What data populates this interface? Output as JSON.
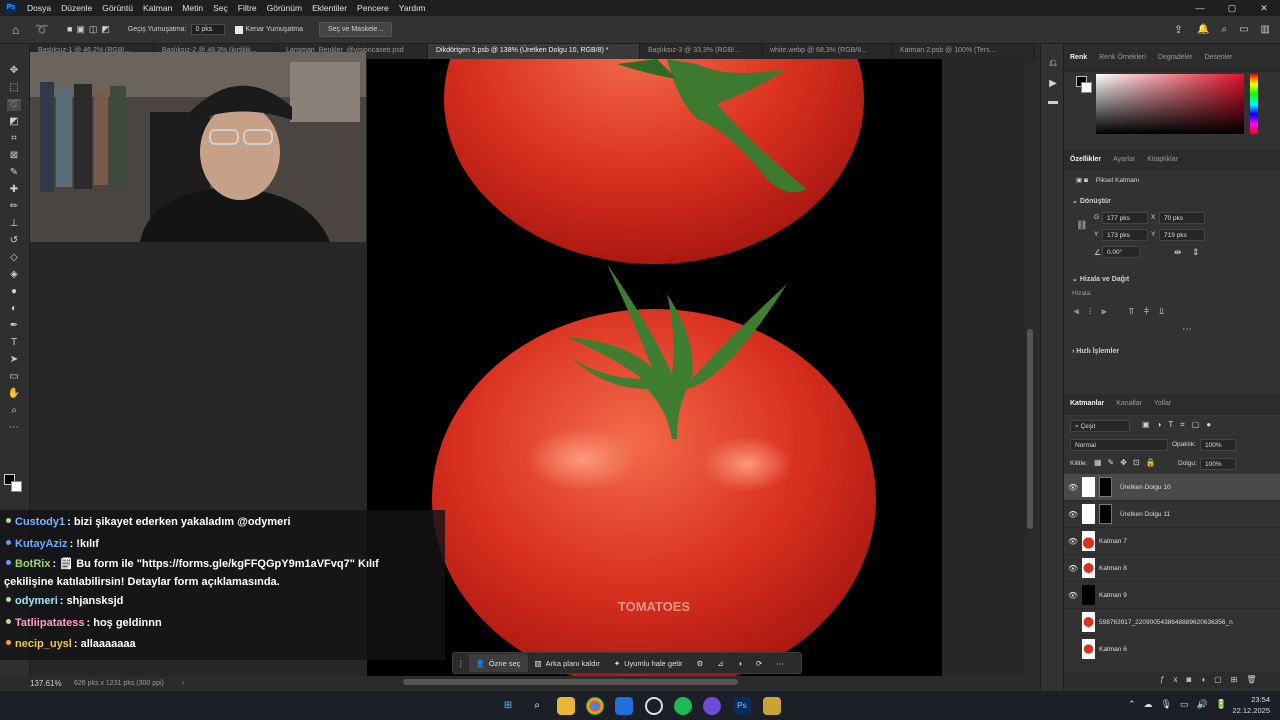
{
  "app": {
    "logo": "Ps"
  },
  "menu": [
    "Dosya",
    "Düzenle",
    "Görüntü",
    "Katman",
    "Metin",
    "Seç",
    "Filtre",
    "Görünüm",
    "Eklentiler",
    "Pencere",
    "Yardım"
  ],
  "window_controls": [
    "—",
    "▢",
    "✕"
  ],
  "options": {
    "feather_label": "Geçiş Yumuşatma:",
    "feather_value": "0 pks",
    "antialias_label": "Kenar Yumuşatma",
    "select_mask": "Seç ve Maskele..."
  },
  "tabs": [
    "Başlıksız-1 @ 46,2% (RGB/...",
    "Başlıksız-2 @ 48,3% (kırtlilik...",
    "Lansman_Renkler_@visioncasetr.psd",
    "Dikdörtgen 3.psb @ 138% (Üretken Dolgu 10, RGB/8) *",
    "Başlıksız-3 @ 33,3% (RGB/...",
    "white.webp @ 68,3% (RGB/8...",
    "Katman 2.psb @ 100% (Ters..."
  ],
  "canvas": {
    "watermark_text": "TOMATOES"
  },
  "chat": [
    {
      "user": "Custody1",
      "color": "#7fb2ff",
      "text": ": bizi şikayet ederken yakaladım @odymeri"
    },
    {
      "user": "KutayAziz",
      "color": "#6fa8ff",
      "text": ": !kılıf"
    },
    {
      "user": "BotRix",
      "color": "#9bd36a",
      "text": ": 🗒 Bu form ile \"https://forms.gle/kgFFQGpY9m1aVFvq7\" Kılıf",
      "text2": "çekilişine katılabilirsin! Detaylar form açıklamasında."
    },
    {
      "user": "odymeri",
      "color": "#9ee6ff",
      "text": ": shjansksjd"
    },
    {
      "user": "Tatliipatatess",
      "color": "#ff9fc7",
      "text": ": hoş geldinnn"
    },
    {
      "user": "necip_uysl",
      "color": "#f5c542",
      "text": ": allaaaaaaa"
    }
  ],
  "contextbar": {
    "select_subject": "Özne seç",
    "remove_bg": "Arka planı kaldır",
    "harmonize": "Uyumlu hale getir"
  },
  "status": {
    "zoom": "137.61%",
    "doc_size": "626 pks x 1231 pks (300 ppi)"
  },
  "panels": {
    "color_tabs": [
      "Renk",
      "Renk Örnekleri",
      "Degradeler",
      "Desenler"
    ],
    "prop_tabs": [
      "Özellikler",
      "Ayarlar",
      "Kitaplıklar"
    ],
    "pixel_layer": "Piksel Katmanı",
    "transform_title": "Dönüştür",
    "w": "177 pks",
    "h": "173 pks",
    "x": "70 pks",
    "y": "719 pks",
    "w_label": "G",
    "h_label": "Y",
    "x_label": "X",
    "y_label": "Y",
    "angle": "0.00°",
    "align_title": "Hizala ve Dağıt",
    "align_label": "Hizala:",
    "quick_title": "Hızlı İşlemler",
    "layer_tabs": [
      "Katmanlar",
      "Kanallar",
      "Yollar"
    ],
    "filter_kind": "Çeşit",
    "blend_mode": "Normal",
    "opacity_label": "Opaklık:",
    "opacity": "100%",
    "lock_label": "Kilitle:",
    "fill_label": "Dolgu:",
    "fill": "100%"
  },
  "layers": [
    {
      "name": "Üretken Dolgu 10",
      "selected": true,
      "visible": true,
      "mask": true
    },
    {
      "name": "Üretken Dolgu 11",
      "selected": false,
      "visible": true,
      "mask": true
    },
    {
      "name": "Katman 7",
      "selected": false,
      "visible": true,
      "mask": false
    },
    {
      "name": "Katman 8",
      "selected": false,
      "visible": true,
      "mask": false
    },
    {
      "name": "Katman 9",
      "selected": false,
      "visible": true,
      "mask": false
    },
    {
      "name": "598763917_2209005438648889620636356_n",
      "selected": false,
      "visible": false,
      "mask": false
    },
    {
      "name": "Katman 6",
      "selected": false,
      "visible": false,
      "mask": false
    }
  ],
  "system": {
    "time": "23:54",
    "date": "22.12.2025"
  }
}
